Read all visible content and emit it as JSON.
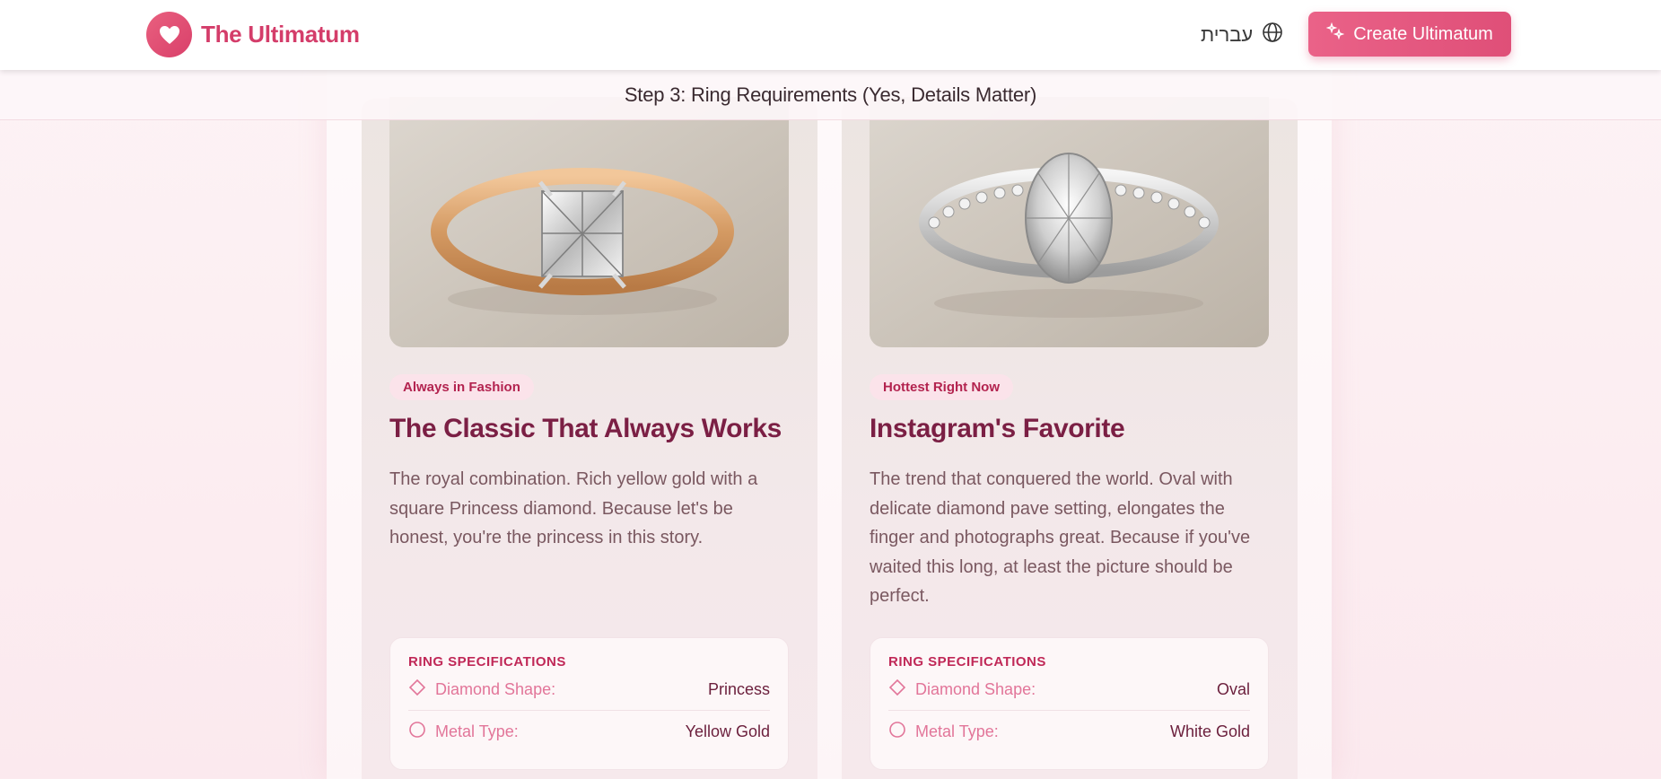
{
  "header": {
    "brand": "The Ultimatum",
    "language": "עברית",
    "cta_label": "Create Ultimatum"
  },
  "step": {
    "title": "Step 3: Ring Requirements (Yes, Details Matter)"
  },
  "cards": [
    {
      "badge": "Always in Fashion",
      "title": "The Classic That Always Works",
      "description": "The royal combination. Rich yellow gold with a square Princess diamond. Because let's be honest, you're the princess in this story.",
      "specs_title": "RING SPECIFICATIONS",
      "specs": [
        {
          "label": "Diamond Shape:",
          "value": "Princess",
          "icon": "diamond-icon"
        },
        {
          "label": "Metal Type:",
          "value": "Yellow Gold",
          "icon": "circle-icon"
        }
      ],
      "image": "yellow-gold-princess-ring"
    },
    {
      "badge": "Hottest Right Now",
      "title": "Instagram's Favorite",
      "description": "The trend that conquered the world. Oval with delicate diamond pave setting, elongates the finger and photographs great. Because if you've waited this long, at least the picture should be perfect.",
      "specs_title": "RING SPECIFICATIONS",
      "specs": [
        {
          "label": "Diamond Shape:",
          "value": "Oval",
          "icon": "diamond-icon"
        },
        {
          "label": "Metal Type:",
          "value": "White Gold",
          "icon": "circle-icon"
        }
      ],
      "image": "white-gold-oval-pave-ring"
    }
  ],
  "colors": {
    "brand": "#d43d6a",
    "accent": "#e65d84",
    "title": "#7b1f44"
  }
}
